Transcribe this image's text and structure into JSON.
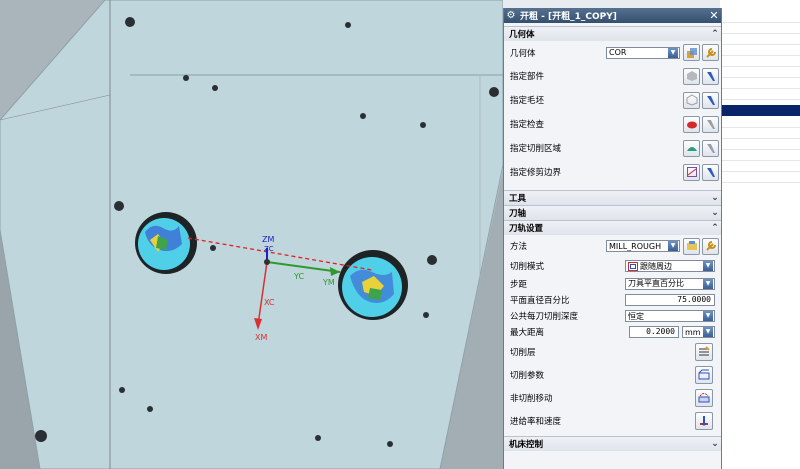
{
  "dialog": {
    "title": "开粗 - [开粗_1_COPY]",
    "groups": {
      "geometry": "几何体",
      "tool": "工具",
      "axis": "刀轴",
      "path_settings": "刀轨设置",
      "machine_control": "机床控制"
    },
    "geometry": {
      "geometry_label": "几何体",
      "geometry_value": "COR",
      "specify_part": "指定部件",
      "specify_blank": "指定毛坯",
      "specify_check": "指定检查",
      "specify_cut_area": "指定切削区域",
      "specify_trim_boundary": "指定修剪边界"
    },
    "path": {
      "method_label": "方法",
      "method_value": "MILL_ROUGH",
      "cut_pattern_label": "切削模式",
      "cut_pattern_value": "跟随周边",
      "stepover_label": "步距",
      "stepover_value": "刀具平直百分比",
      "flat_diameter_label": "平面直径百分比",
      "flat_diameter_value": "75.0000",
      "common_depth_label": "公共每刀切削深度",
      "common_depth_value": "恒定",
      "max_distance_label": "最大距离",
      "max_distance_value": "0.2000",
      "max_distance_unit": "mm",
      "cut_levels": "切削层",
      "cut_params": "切削参数",
      "non_cut_moves": "非切削移动",
      "feeds_speeds": "进给率和速度"
    }
  },
  "csys": {
    "zm": "ZM",
    "zc": "ZC",
    "yc": "YC",
    "ym": "YM",
    "xc": "XC",
    "xm": "XM"
  },
  "colors": {
    "part_face": "#bfd6dc",
    "accent_blue": "#0a246a",
    "title_bar": "#34506e"
  }
}
